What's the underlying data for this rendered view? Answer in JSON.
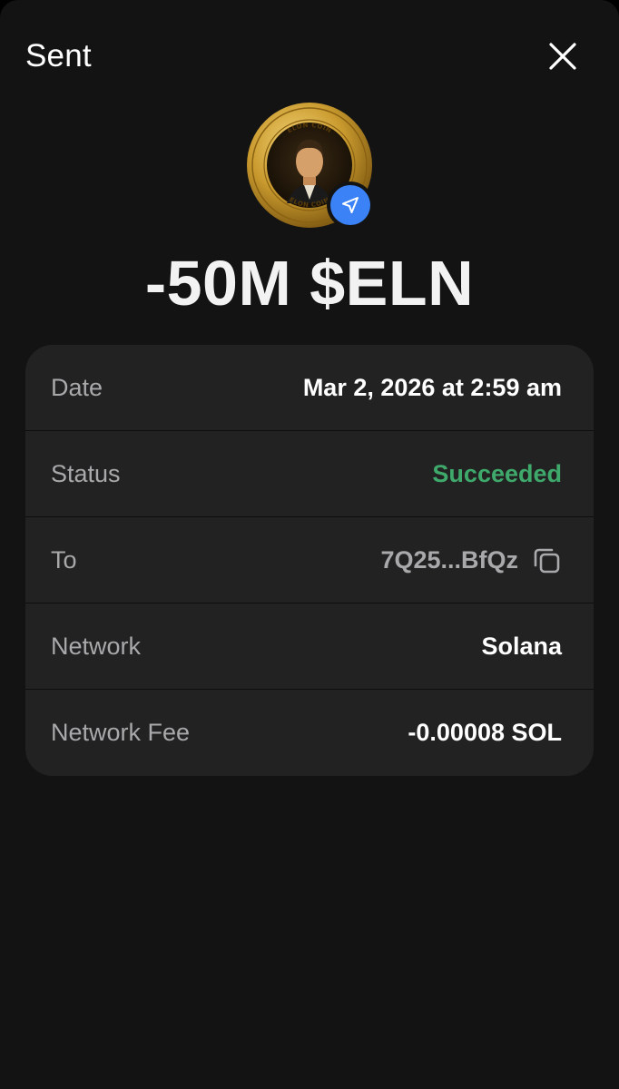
{
  "header": {
    "title": "Sent"
  },
  "icons": {
    "close": "close-icon",
    "token": "elon-coin-icon",
    "send": "paper-plane-icon",
    "copy": "copy-icon"
  },
  "token": {
    "coin_text_top": "ELON COIN",
    "coin_text_bottom": "ELON COIN",
    "coin_text_left": "CRYPTO CURRENCY",
    "coin_text_right": "CRYPTO CURRENCY"
  },
  "transaction": {
    "amount": "-50M $ELN"
  },
  "details": {
    "date_label": "Date",
    "date_value": "Mar 2, 2026 at 2:59 am",
    "status_label": "Status",
    "status_value": "Succeeded",
    "to_label": "To",
    "to_value": "7Q25...BfQz",
    "network_label": "Network",
    "network_value": "Solana",
    "fee_label": "Network Fee",
    "fee_value": "-0.00008 SOL"
  },
  "colors": {
    "background": "#131313",
    "card": "#222222",
    "success": "#3fa86b",
    "accent_blue": "#3b82f6",
    "label_gray": "#a9a9ab"
  }
}
